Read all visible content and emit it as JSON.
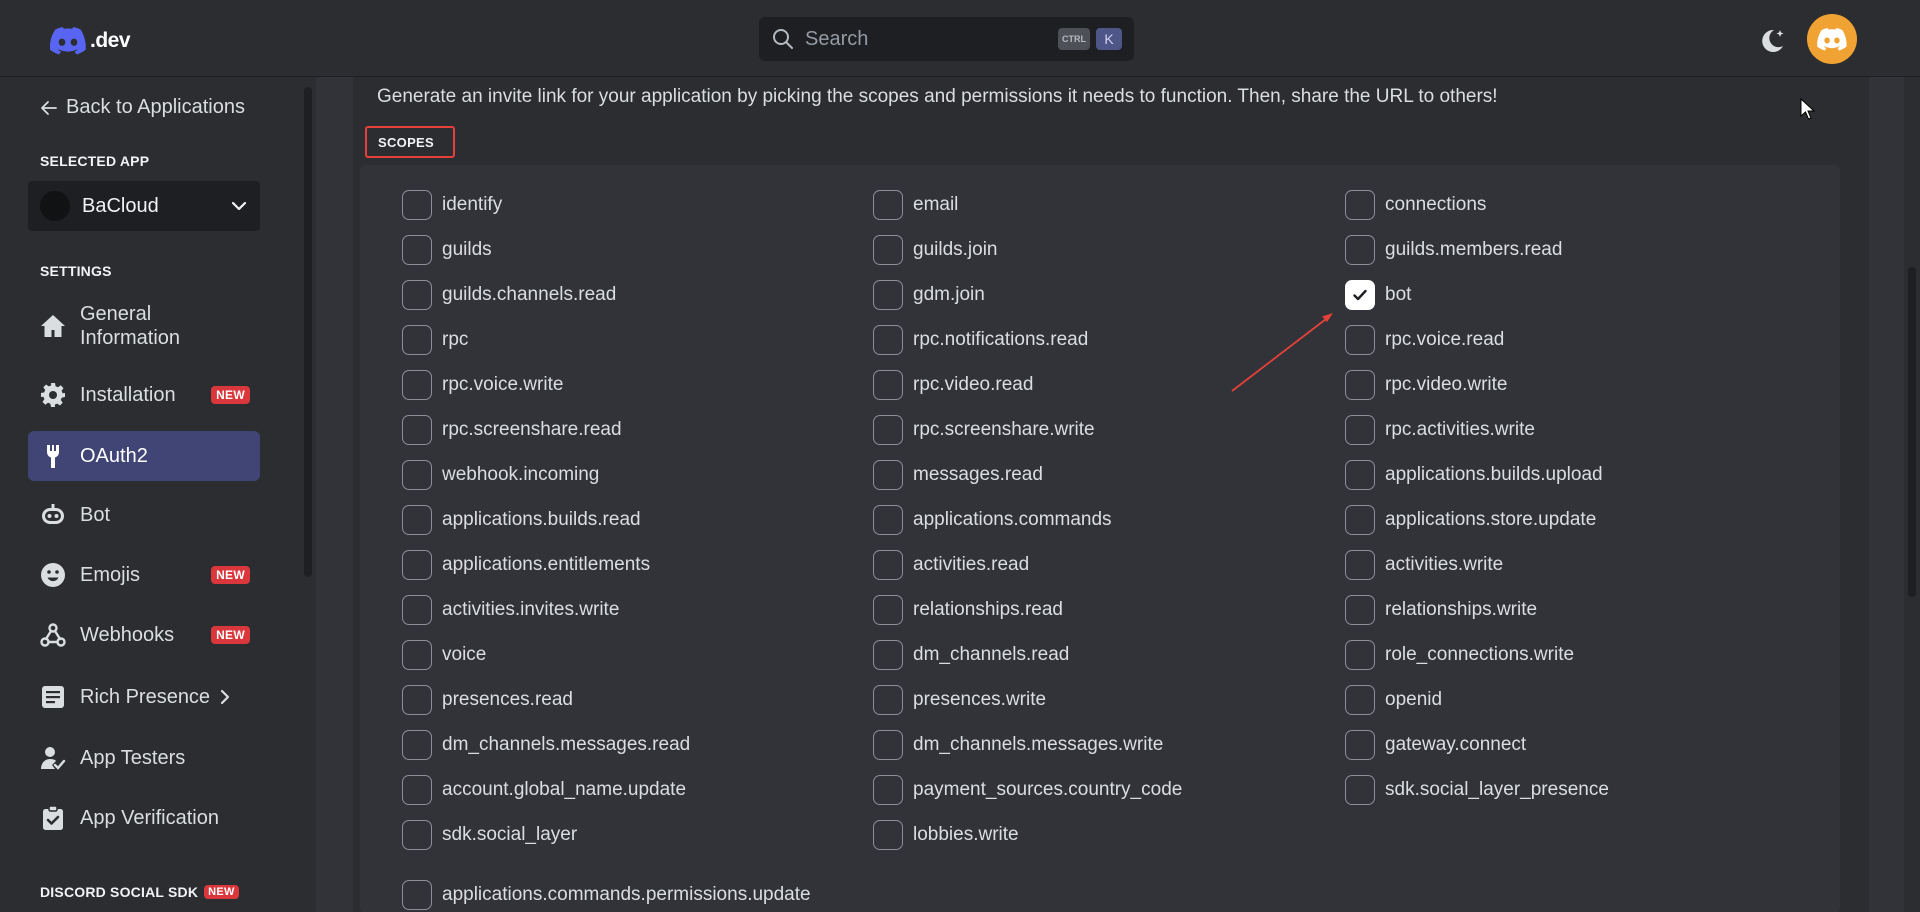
{
  "topbar": {
    "logo_text": ".dev",
    "search_placeholder": "Search",
    "shortcut_mod": "CTRL",
    "shortcut_key": "K"
  },
  "sidebar": {
    "back_label": "Back to Applications",
    "selected_app_label": "SELECTED APP",
    "app_name": "BaCloud",
    "settings_label": "SETTINGS",
    "items": [
      {
        "label": "General Information",
        "icon": "home-icon",
        "badge": ""
      },
      {
        "label": "Installation",
        "icon": "gear-icon",
        "badge": "NEW"
      },
      {
        "label": "OAuth2",
        "icon": "wrench-icon",
        "badge": "",
        "active": true
      },
      {
        "label": "Bot",
        "icon": "robot-icon",
        "badge": ""
      },
      {
        "label": "Emojis",
        "icon": "smiley-icon",
        "badge": "NEW"
      },
      {
        "label": "Webhooks",
        "icon": "webhook-icon",
        "badge": "NEW"
      },
      {
        "label": "Rich Presence",
        "icon": "document-icon",
        "badge": ""
      },
      {
        "label": "App Testers",
        "icon": "person-icon",
        "badge": ""
      },
      {
        "label": "App Verification",
        "icon": "clipboard-check-icon",
        "badge": ""
      }
    ],
    "social_sdk_label": "DISCORD SOCIAL SDK",
    "social_sdk_badge": "NEW"
  },
  "main": {
    "intro": "Generate an invite link for your application by picking the scopes and permissions it needs to function. Then, share the URL to others!",
    "scopes_title": "SCOPES",
    "scopes": [
      {
        "label": "identify",
        "checked": false
      },
      {
        "label": "email",
        "checked": false
      },
      {
        "label": "connections",
        "checked": false
      },
      {
        "label": "guilds",
        "checked": false
      },
      {
        "label": "guilds.join",
        "checked": false
      },
      {
        "label": "guilds.members.read",
        "checked": false
      },
      {
        "label": "guilds.channels.read",
        "checked": false
      },
      {
        "label": "gdm.join",
        "checked": false
      },
      {
        "label": "bot",
        "checked": true
      },
      {
        "label": "rpc",
        "checked": false
      },
      {
        "label": "rpc.notifications.read",
        "checked": false
      },
      {
        "label": "rpc.voice.read",
        "checked": false
      },
      {
        "label": "rpc.voice.write",
        "checked": false
      },
      {
        "label": "rpc.video.read",
        "checked": false
      },
      {
        "label": "rpc.video.write",
        "checked": false
      },
      {
        "label": "rpc.screenshare.read",
        "checked": false
      },
      {
        "label": "rpc.screenshare.write",
        "checked": false
      },
      {
        "label": "rpc.activities.write",
        "checked": false
      },
      {
        "label": "webhook.incoming",
        "checked": false
      },
      {
        "label": "messages.read",
        "checked": false
      },
      {
        "label": "applications.builds.upload",
        "checked": false
      },
      {
        "label": "applications.builds.read",
        "checked": false
      },
      {
        "label": "applications.commands",
        "checked": false
      },
      {
        "label": "applications.store.update",
        "checked": false
      },
      {
        "label": "applications.entitlements",
        "checked": false
      },
      {
        "label": "activities.read",
        "checked": false
      },
      {
        "label": "activities.write",
        "checked": false
      },
      {
        "label": "activities.invites.write",
        "checked": false
      },
      {
        "label": "relationships.read",
        "checked": false
      },
      {
        "label": "relationships.write",
        "checked": false
      },
      {
        "label": "voice",
        "checked": false
      },
      {
        "label": "dm_channels.read",
        "checked": false
      },
      {
        "label": "role_connections.write",
        "checked": false
      },
      {
        "label": "presences.read",
        "checked": false
      },
      {
        "label": "presences.write",
        "checked": false
      },
      {
        "label": "openid",
        "checked": false
      },
      {
        "label": "dm_channels.messages.read",
        "checked": false
      },
      {
        "label": "dm_channels.messages.write",
        "checked": false
      },
      {
        "label": "gateway.connect",
        "checked": false
      },
      {
        "label": "account.global_name.update",
        "checked": false
      },
      {
        "label": "payment_sources.country_code",
        "checked": false
      },
      {
        "label": "sdk.social_layer_presence",
        "checked": false
      },
      {
        "label": "sdk.social_layer",
        "checked": false
      },
      {
        "label": "lobbies.write",
        "checked": false
      },
      {
        "label": "applications.commands.permissions.update",
        "checked": false
      }
    ]
  },
  "colors": {
    "accent": "#5865f2",
    "badge_red": "#da373c",
    "annotation_red": "#e5413a",
    "avatar_orange": "#f0a232"
  }
}
